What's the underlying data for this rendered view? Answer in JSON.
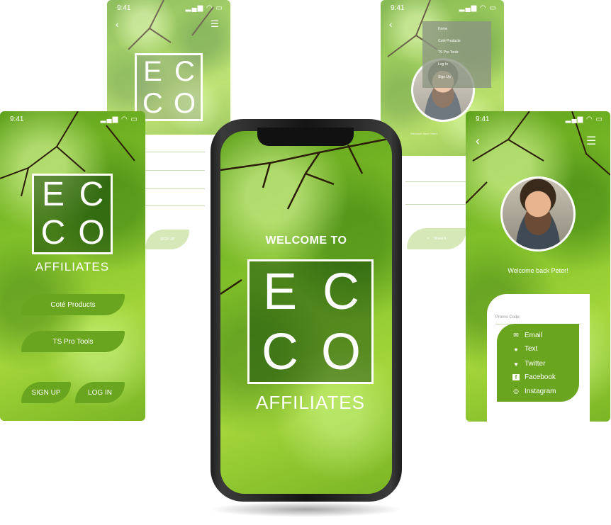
{
  "status_time": "9:41",
  "status_icons": "▂▄▆ ◠ ▭",
  "logo": {
    "letters": [
      "E",
      "C",
      "C",
      "O"
    ],
    "tagline": "AFFILIATES"
  },
  "splash": {
    "welcome": "WELCOME TO"
  },
  "screens": {
    "home": {
      "menu_buttons": [
        "Coté Products",
        "TS Pro Tools"
      ],
      "signup_label": "SIGN UP",
      "login_label": "LOG IN"
    },
    "signup_form": {
      "button_label": "SIGN UP"
    },
    "menu_overlay": {
      "items": [
        "Home",
        "Coté Products",
        "TS Pro Tools",
        "Log In",
        "Sign Up"
      ],
      "welcome": "Welcome back Peter!",
      "share_label": "Share it"
    },
    "profile": {
      "welcome": "Welcome back Peter!",
      "promo_label": "Promo Code:",
      "share_options": [
        {
          "icon": "email-icon",
          "label": "Email"
        },
        {
          "icon": "text-message-icon",
          "label": "Text"
        },
        {
          "icon": "twitter-icon",
          "label": "Twitter"
        },
        {
          "icon": "facebook-icon",
          "label": "Facebook"
        },
        {
          "icon": "instagram-icon",
          "label": "Instagram"
        }
      ]
    }
  },
  "colors": {
    "leaf_green": "#82c12a",
    "dark_green": "#2f6d0c",
    "pill_green": "#6aa51f"
  }
}
